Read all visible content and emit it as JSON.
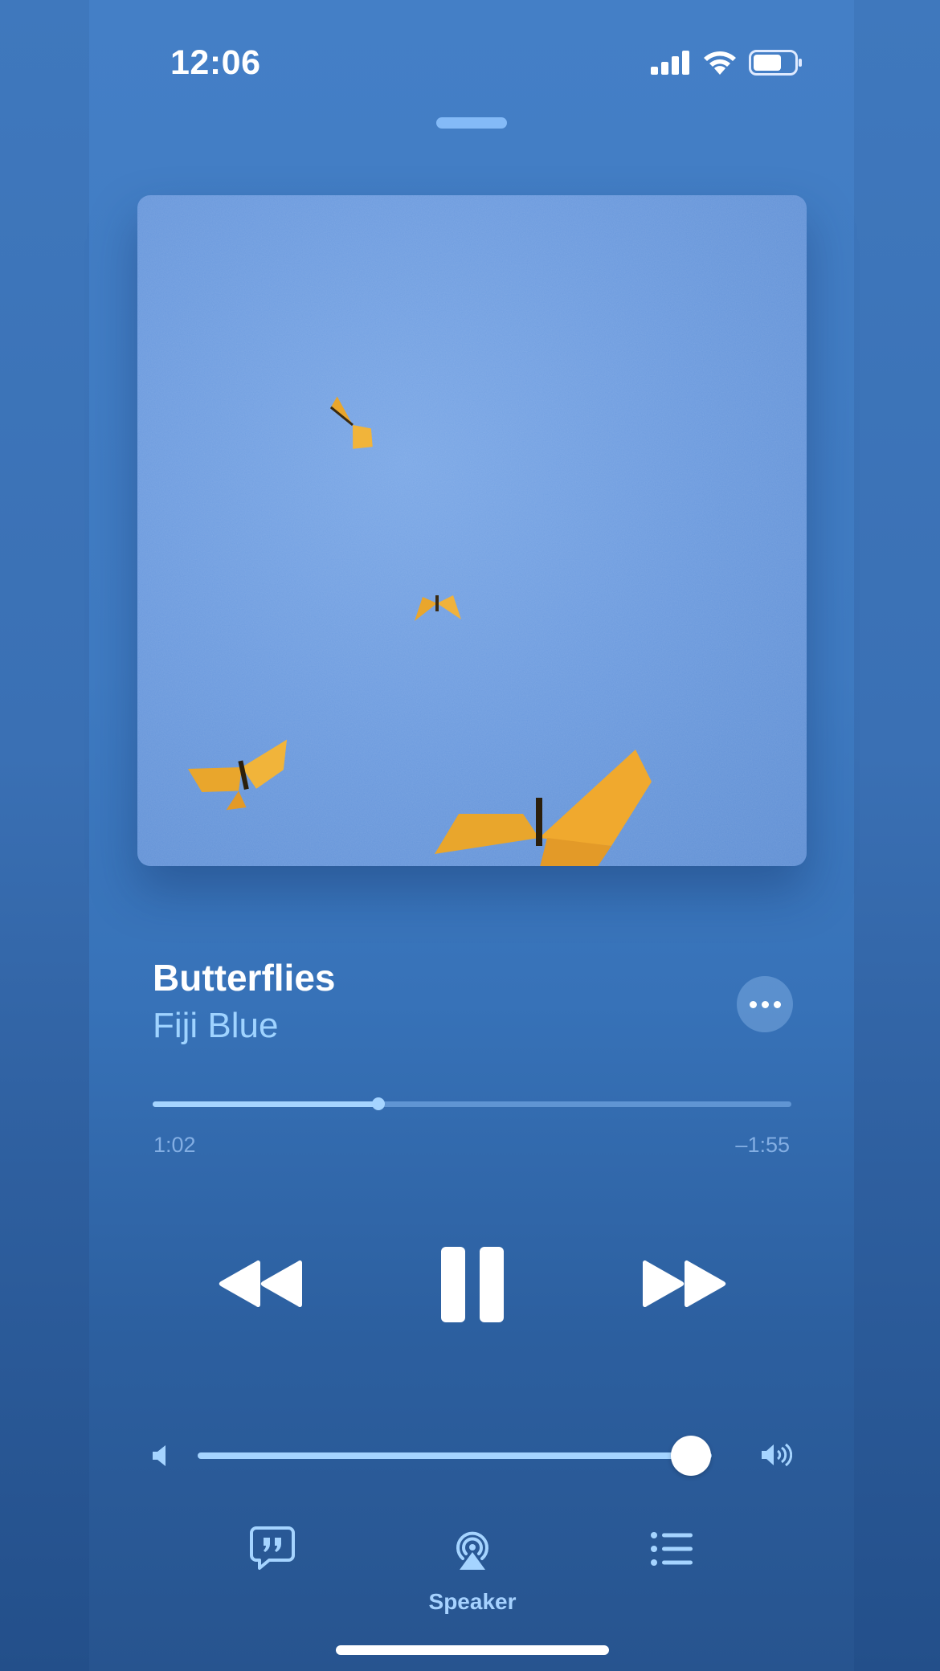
{
  "status_bar": {
    "time": "12:06",
    "icons": [
      "signal-icon",
      "wifi-icon",
      "battery-icon"
    ]
  },
  "now_playing": {
    "title": "Butterflies",
    "artist": "Fiji Blue",
    "elapsed": "1:02",
    "remaining": "–1:55",
    "progress": 0.354,
    "volume": 0.96
  },
  "controls": [
    "rewind-icon",
    "pause-icon",
    "fast-forward-icon"
  ],
  "bottom_bar": {
    "lyrics_icon": "quote-bubble-icon",
    "airplay_icon": "airplay-audio-icon",
    "airplay_label": "Speaker",
    "queue_icon": "list-icon"
  },
  "colors": {
    "background": "#3f7bc2",
    "accent": "#a5d4ff",
    "artist_text": "#9fd3ff",
    "artwork_sky": "#6b9ade",
    "butterfly": "#e9a62c"
  }
}
